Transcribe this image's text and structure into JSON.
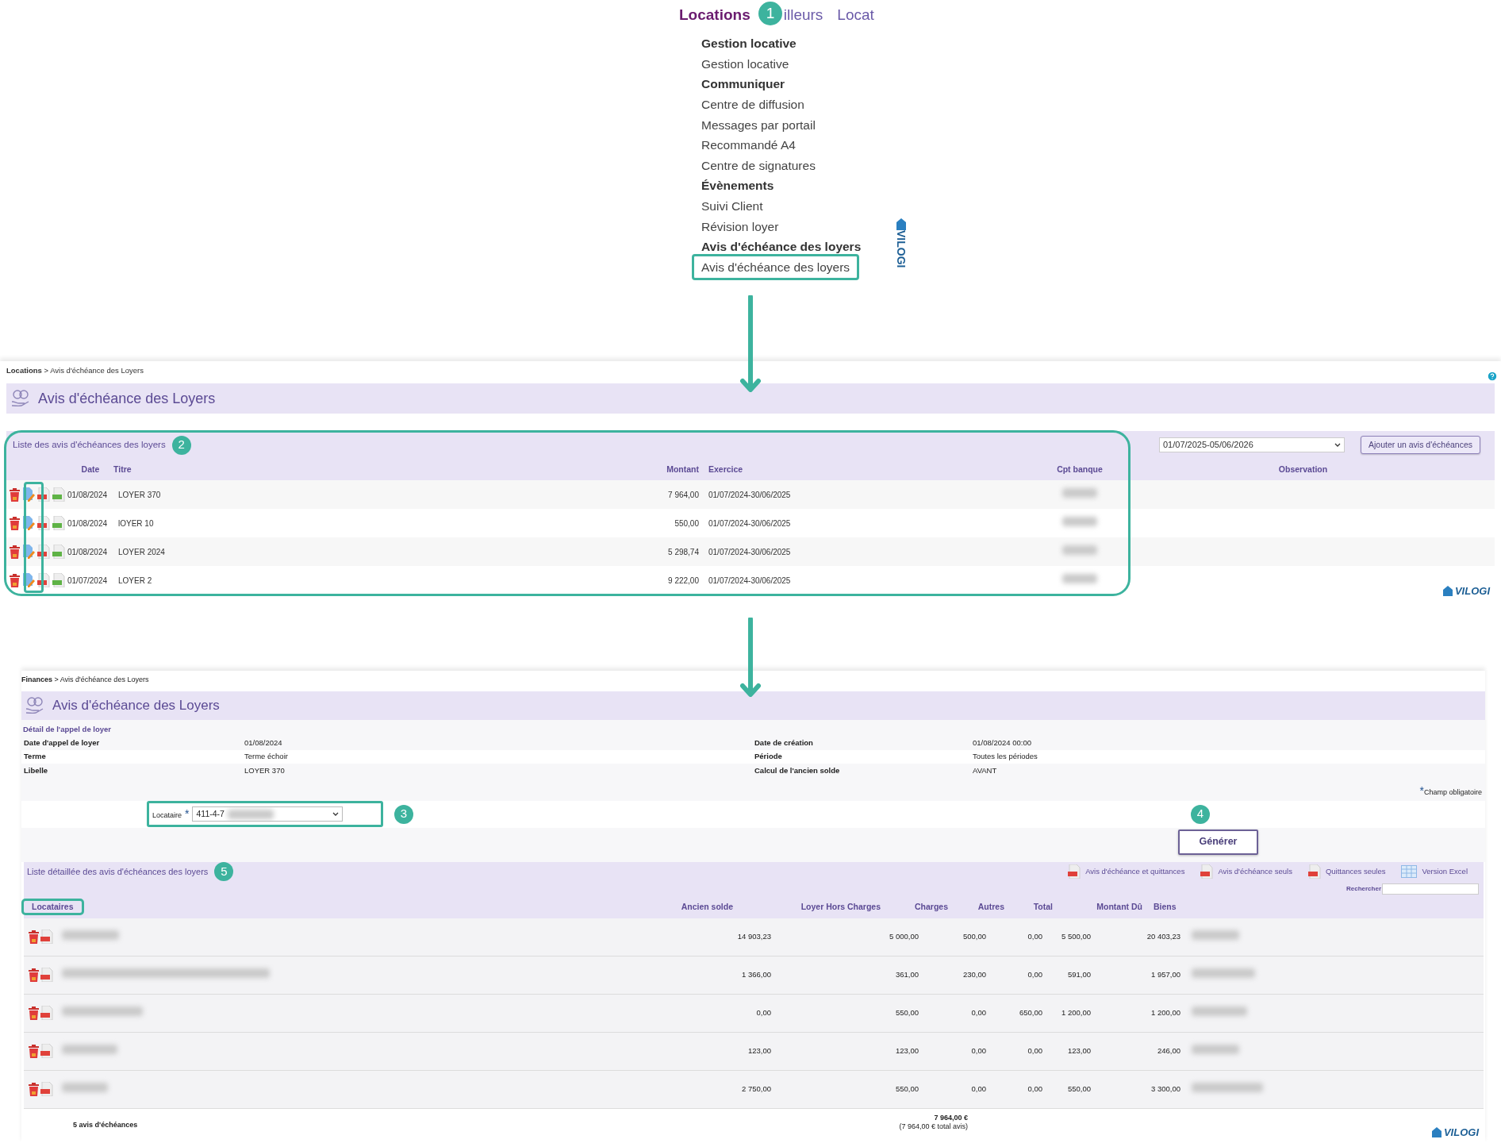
{
  "menu": {
    "badge": "1",
    "tabs": [
      {
        "label": "Locations",
        "selected": true
      },
      {
        "label": "illeurs",
        "selected": false
      },
      {
        "label": "Locat",
        "selected": false
      }
    ],
    "items": [
      {
        "label": "Gestion locative",
        "kind": "heading",
        "highlighted": false
      },
      {
        "label": "Gestion locative",
        "kind": "link",
        "highlighted": false
      },
      {
        "label": "Communiquer",
        "kind": "heading",
        "highlighted": false
      },
      {
        "label": "Centre de diffusion",
        "kind": "link",
        "highlighted": false
      },
      {
        "label": "Messages par portail",
        "kind": "link",
        "highlighted": false
      },
      {
        "label": "Recommandé A4",
        "kind": "link",
        "highlighted": false
      },
      {
        "label": "Centre de signatures",
        "kind": "link",
        "highlighted": false
      },
      {
        "label": "Évènements",
        "kind": "heading",
        "highlighted": false
      },
      {
        "label": "Suivi Client",
        "kind": "link",
        "highlighted": false
      },
      {
        "label": "Révision loyer",
        "kind": "link",
        "highlighted": false
      },
      {
        "label": "Avis d'échéance des loyers",
        "kind": "heading",
        "highlighted": false
      },
      {
        "label": "Avis d'échéance des loyers",
        "kind": "link",
        "highlighted": true
      }
    ],
    "logo": "VILOGI"
  },
  "list_screen": {
    "breadcrumb": "**Locations** > Avis d'échéance des Loyers",
    "title": "Avis d'échéance des Loyers",
    "panel_title": "Liste des avis d'échéances des loyers",
    "badge": "2",
    "highlighted": true,
    "edit_column_highlighted": true,
    "period": "01/07/2025-05/06/2026",
    "add_button": "Ajouter un avis d'échéances",
    "columns": [
      "Date",
      "Titre",
      "Montant",
      "Exercice",
      "Cpt banque",
      "Observation"
    ],
    "rows": [
      {
        "date": "01/08/2024",
        "title": "LOYER 370",
        "amount": "7 964,00",
        "exercise": "01/07/2024-30/06/2025"
      },
      {
        "date": "01/08/2024",
        "title": "lOYER 10",
        "amount": "550,00",
        "exercise": "01/07/2024-30/06/2025"
      },
      {
        "date": "01/08/2024",
        "title": "LOYER 2024",
        "amount": "5 298,74",
        "exercise": "01/07/2024-30/06/2025"
      },
      {
        "date": "01/07/2024",
        "title": "LOYER 2",
        "amount": "9 222,00",
        "exercise": "01/07/2024-30/06/2025"
      }
    ],
    "logo": "VILOGI"
  },
  "detail_screen": {
    "breadcrumb": "**Finances** > Avis d'échéance des Loyers",
    "title": "Avis d'échéance des Loyers",
    "detail_title": "Détail de l'appel de loyer",
    "details": [
      {
        "label": "Date d'appel de loyer",
        "value": "01/08/2024",
        "label_2": "Date de création",
        "value_2": "01/08/2024 00:00"
      },
      {
        "label": "Terme",
        "value": "Terme échoir",
        "label_2": "Période",
        "value_2": "Toutes les périodes"
      },
      {
        "label": "Libelle",
        "value": "LOYER 370",
        "label_2": "Calcul de l'ancien solde",
        "value_2": "AVANT"
      }
    ],
    "required_mark": "*",
    "required_note": "Champ obligatoire",
    "tenant_field": {
      "label": "Locataire",
      "required_mark": "*",
      "value": "411-4-7",
      "badge": "3",
      "highlighted": true
    },
    "generate_badge": "4",
    "generate_button": "Générer",
    "list_title": "Liste détaillée des avis d'échéances des loyers",
    "list_badge": "5",
    "exports": [
      {
        "label": "Avis d'échéance et quittances",
        "kind": "pdf"
      },
      {
        "label": "Avis d'échéance seuls",
        "kind": "pdf"
      },
      {
        "label": "Quittances seules",
        "kind": "pdf"
      },
      {
        "label": "Version Excel",
        "kind": "excel"
      }
    ],
    "search_label": "Rechercher",
    "columns": [
      {
        "label": "Locataires",
        "highlighted": true
      },
      {
        "label": "Ancien solde",
        "highlighted": false
      },
      {
        "label": "Loyer Hors Charges",
        "highlighted": false
      },
      {
        "label": "Charges",
        "highlighted": false
      },
      {
        "label": "Autres",
        "highlighted": false
      },
      {
        "label": "Total",
        "highlighted": false
      },
      {
        "label": "Montant Dû",
        "highlighted": false
      },
      {
        "label": "Biens",
        "highlighted": false
      }
    ],
    "rows": [
      {
        "old_balance": "14 903,23",
        "rent": "5 000,00",
        "charges": "500,00",
        "other": "0,00",
        "total": "5 500,00",
        "due": "20 403,23"
      },
      {
        "old_balance": "1 366,00",
        "rent": "361,00",
        "charges": "230,00",
        "other": "0,00",
        "total": "591,00",
        "due": "1 957,00"
      },
      {
        "old_balance": "0,00",
        "rent": "550,00",
        "charges": "0,00",
        "other": "650,00",
        "total": "1 200,00",
        "due": "1 200,00"
      },
      {
        "old_balance": "123,00",
        "rent": "123,00",
        "charges": "0,00",
        "other": "0,00",
        "total": "123,00",
        "due": "246,00"
      },
      {
        "old_balance": "2 750,00",
        "rent": "550,00",
        "charges": "0,00",
        "other": "0,00",
        "total": "550,00",
        "due": "3 300,00"
      }
    ],
    "footer": {
      "count": "5 avis d'échéances",
      "total": "7 964,00 €",
      "total_note": "(7 964,00 € total avis)"
    },
    "logo": "VILOGI"
  }
}
